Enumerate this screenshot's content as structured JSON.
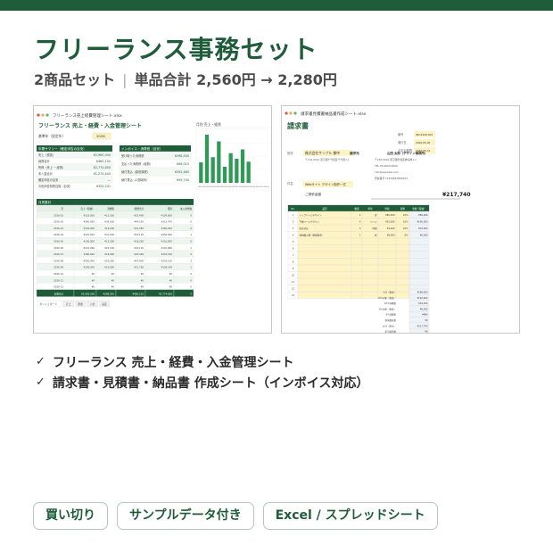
{
  "title": "フリーランス事務セット",
  "subtitle": {
    "left": "2商品セット",
    "separator": "|",
    "right": "単品合計 2,560円 → 2,280円"
  },
  "features": [
    "フリーランス 売上・経費・入金管理シート",
    "請求書・見積書・納品書 作成シート（インボイス対応）"
  ],
  "feature_icon": "check-icon",
  "tags": [
    "買い切り",
    "サンプルデータ付き",
    "Excel / スプレッドシート"
  ],
  "colors": {
    "accent": "#1e5c3a",
    "bar": "#2e9a55",
    "invoice_fill": "#fdf3c4"
  },
  "preview1": {
    "file_title": "フリーランス売上経費管理シート.xlsx",
    "sheet_title": "フリーランス 売上・経費・入金管理シート",
    "year_label": "基準年（設定年）",
    "year_value": "2026",
    "summary_header": "年間サマリー（確定申告の目安）",
    "summary_rows": [
      {
        "label": "売上（税抜）",
        "value": "¥2,985,000"
      },
      {
        "label": "経費合計",
        "value": "¥460,150"
      },
      {
        "label": "所得（売上 − 経費）",
        "value": "¥2,774,850"
      },
      {
        "label": "未入金合計",
        "value": "¥1,274,400"
      },
      {
        "label": "確定申告の目安",
        "value": "—"
      },
      {
        "label": "青色申告特別控除（目安）",
        "value": "¥325,231"
      }
    ],
    "stats_header": "インボイス・消費税（目安）",
    "stats_rows": [
      {
        "label": "受け取った消費税",
        "value": "¥298,500"
      },
      {
        "label": "支払った消費税（経費）",
        "value": "¥46,015"
      },
      {
        "label": "納付見込（原則課税）",
        "value": "¥252,485"
      },
      {
        "label": "納付見込（2割特例）",
        "value": "¥59,700"
      }
    ],
    "chart_title": "月別 売上・経費",
    "monthly_header": "月別集計",
    "monthly_columns": [
      "月",
      "売上（税抜）",
      "消費税",
      "経費合計",
      "所得",
      "未入金件数"
    ],
    "monthly_rows": [
      [
        "2026-01",
        "¥153,000",
        "¥15,300",
        "¥23,400",
        "¥129,600",
        "0"
      ],
      [
        "2026-02",
        "¥360,000",
        "¥36,000",
        "¥44,530",
        "¥315,470",
        "0"
      ],
      [
        "2026-03",
        "¥192,000",
        "¥19,200",
        "¥31,350",
        "¥160,650",
        "0"
      ],
      [
        "2026-04",
        "¥310,000",
        "¥31,000",
        "¥53,100",
        "¥256,900",
        "1"
      ],
      [
        "2026-05",
        "¥120,000",
        "¥12,000",
        "¥18,200",
        "¥101,800",
        "0"
      ],
      [
        "2026-06",
        "¥222,000",
        "¥22,200",
        "¥30,120",
        "¥191,880",
        "1"
      ],
      [
        "2026-07",
        "¥180,000",
        "¥18,000",
        "¥25,460",
        "¥154,540",
        "0"
      ],
      [
        "2026-08",
        "¥250,000",
        "¥25,000",
        "¥47,900",
        "¥202,100",
        "2"
      ],
      [
        "2026-09",
        "¥158,000",
        "¥15,800",
        "¥21,760",
        "¥136,240",
        "1"
      ],
      [
        "2026-10",
        "¥0",
        "¥0",
        "¥0",
        "¥0",
        "0"
      ],
      [
        "2026-11",
        "¥0",
        "¥0",
        "¥0",
        "¥0",
        "0"
      ],
      [
        "2026-12",
        "¥0",
        "¥0",
        "¥0",
        "¥0",
        "0"
      ]
    ],
    "total_row": [
      "年間合計",
      "¥2,985,000",
      "¥298,500",
      "¥460,150",
      "¥2,774,850",
      "5"
    ],
    "sheet_tabs": [
      "ダッシュボード",
      "売上",
      "経費",
      "入金",
      "設定"
    ]
  },
  "chart_data": {
    "type": "bar",
    "title": "月別 売上・経費",
    "categories": [
      "2026-01",
      "2026-02",
      "2026-03",
      "2026-04",
      "2026-05",
      "2026-06",
      "2026-07",
      "2026-08",
      "2026-09",
      "2026-10",
      "2026-11",
      "2026-12"
    ],
    "values": [
      153000,
      360000,
      192000,
      310000,
      120000,
      222000,
      180000,
      250000,
      158000,
      0,
      0,
      0
    ],
    "ylim": [
      0,
      400000
    ],
    "grid": true,
    "legend": "none"
  },
  "preview2": {
    "file_title": "請求書見積書納品書作成シート.xlsx",
    "doc_title": "請求書",
    "meta": [
      {
        "label": "番号",
        "value": "INV-2026-001"
      },
      {
        "label": "発行日",
        "value": "2026-05-05"
      },
      {
        "label": "お支払期限",
        "value": "2026-05-31"
      }
    ],
    "to_label": "宛先",
    "client": "株式会社サンプル 御中",
    "client_address": "〒100-0001 東京都千代田区千代田1-1",
    "issuer_label": "請求元",
    "issuer_name": "山田 太郎（デザイン事務所）",
    "issuer_lines": [
      "〒150-0001 東京都渋谷区神宮前1-1",
      "TEL 03-0000-0000",
      "info@example.com",
      "登録番号 T1234567890123"
    ],
    "subject_label": "件名",
    "subject": "Webサイト デザイン制作一式",
    "amount_label": "ご請求金額",
    "amount": "¥217,740",
    "columns": [
      "No.",
      "品目",
      "数量",
      "単位",
      "単価",
      "税率",
      "金額（税抜）"
    ],
    "items": [
      [
        "1",
        "トップページデザイン",
        "1",
        "式",
        "¥80,000",
        "10%",
        "¥80,000"
      ],
      [
        "2",
        "下層ページデザイン",
        "4",
        "ページ",
        "¥25,000",
        "10%",
        "¥100,000"
      ],
      [
        "3",
        "修正対応",
        "3",
        "時間",
        "¥4,000",
        "10%",
        "¥12,000"
      ],
      [
        "4",
        "素材購入費（軽減税率）",
        "1",
        "式",
        "¥6,000",
        "8%",
        "¥6,000"
      ]
    ],
    "empty_rows": [
      "5",
      "6",
      "7",
      "8",
      "9",
      "10",
      "11",
      "12",
      "13"
    ],
    "totals": [
      {
        "label": "小計（税抜）",
        "value": "¥198,000"
      },
      {
        "label": "10%対象（税抜）",
        "value": "¥192,000"
      },
      {
        "label": "10%消費税",
        "value": "¥19,200"
      },
      {
        "label": "8%対象（税抜）",
        "value": "¥6,000"
      },
      {
        "label": "8%消費税",
        "value": "¥480"
      },
      {
        "label": "源泉徴収税",
        "value": "¥0"
      },
      {
        "label": "合計（税込）",
        "value": "¥217,740"
      },
      {
        "label": "差引請求額",
        "value": "¥0"
      }
    ]
  }
}
